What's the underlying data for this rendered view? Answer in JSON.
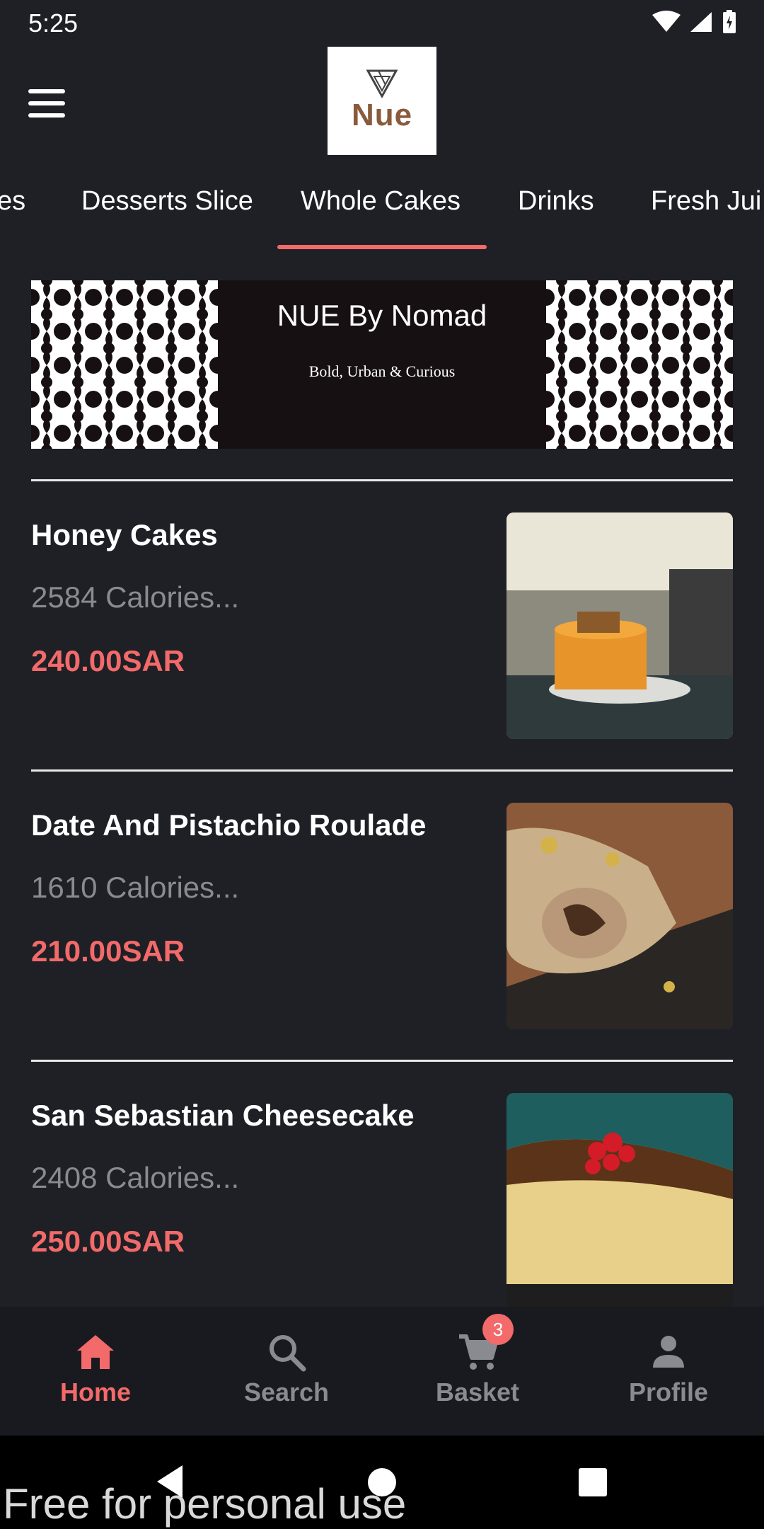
{
  "status_bar": {
    "time": "5:25"
  },
  "header": {
    "logo_text": "Nue"
  },
  "tabs": [
    {
      "label": "es"
    },
    {
      "label": "Desserts Slice"
    },
    {
      "label": "Whole Cakes"
    },
    {
      "label": "Drinks"
    },
    {
      "label": "Fresh Jui"
    }
  ],
  "active_tab": "Whole Cakes",
  "banner": {
    "title": "NUE By Nomad",
    "subtitle": "Bold, Urban & Curious"
  },
  "items": [
    {
      "name": "Honey Cakes",
      "calories": "2584 Calories...",
      "price": "240.00SAR"
    },
    {
      "name": "Date And Pistachio Roulade",
      "calories": "1610 Calories...",
      "price": "210.00SAR"
    },
    {
      "name": "San Sebastian Cheesecake",
      "calories": "2408 Calories...",
      "price": "250.00SAR"
    }
  ],
  "bottom_nav": {
    "home": "Home",
    "search": "Search",
    "basket": "Basket",
    "basket_badge": "3",
    "profile": "Profile"
  },
  "watermark": "Free for personal use",
  "colors": {
    "accent": "#f26a6a",
    "background": "#1f2026",
    "muted": "#8a8b90"
  }
}
